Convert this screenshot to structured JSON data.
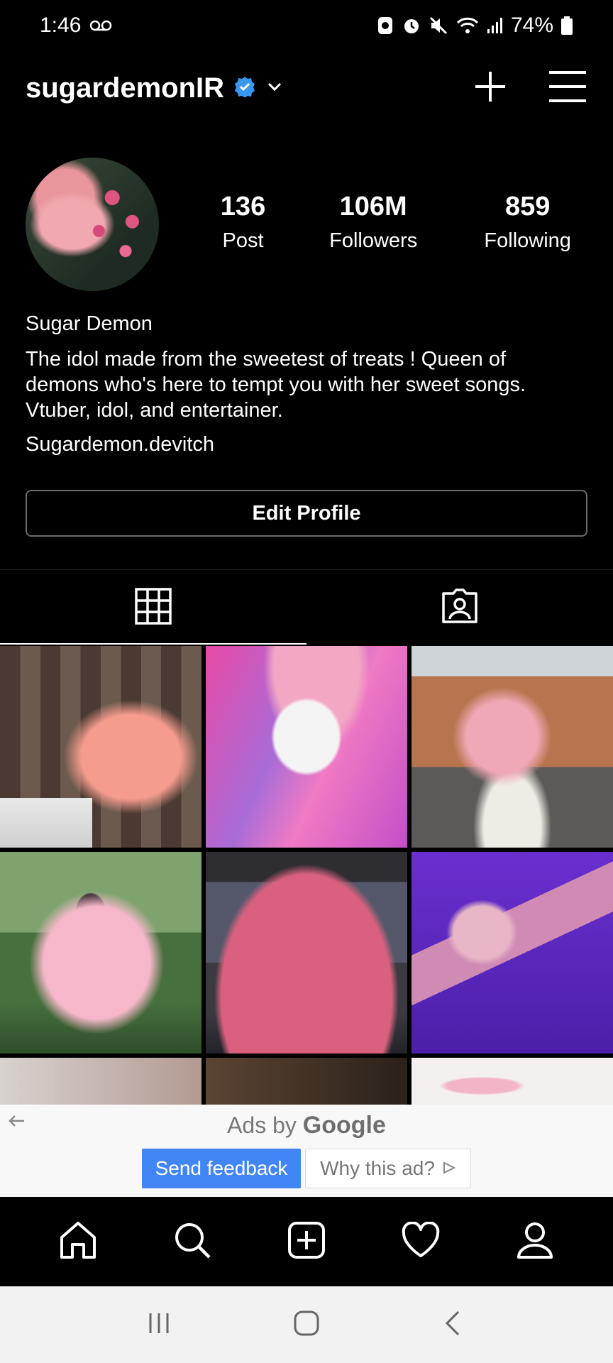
{
  "status_bar": {
    "time": "1:46",
    "battery": "74%",
    "icons": [
      "voicemail-icon",
      "data-saver-icon",
      "alarm-icon",
      "mute-icon",
      "wifi-icon",
      "signal-icon",
      "battery-icon"
    ]
  },
  "header": {
    "username": "sugardemonIR",
    "verified_color": "#3897f0",
    "icons": [
      "verified-badge-icon",
      "chevron-down-icon",
      "plus-icon",
      "menu-icon"
    ]
  },
  "profile": {
    "stats": [
      {
        "value": "136",
        "label": "Post"
      },
      {
        "value": "106M",
        "label": "Followers"
      },
      {
        "value": "859",
        "label": "Following"
      }
    ],
    "name": "Sugar Demon",
    "bio_lines": [
      "The idol made from the sweetest of treats ! Queen of",
      "demons who's here to tempt you with her sweet songs.",
      "Vtuber, idol, and entertainer."
    ],
    "link": "Sugardemon.devitch",
    "edit_button": "Edit Profile"
  },
  "tabs": [
    {
      "icon": "grid-icon",
      "selected": true
    },
    {
      "icon": "tagged-icon",
      "selected": false
    }
  ],
  "ad": {
    "title_prefix": "Ads by",
    "title_brand": "Google",
    "send_feedback": "Send feedback",
    "why_this_ad": "Why this ad?",
    "accent": "#4285f4"
  },
  "bottom_nav": [
    "home-icon",
    "search-icon",
    "new-post-icon",
    "heart-icon",
    "profile-icon"
  ],
  "system_nav": [
    "recents-icon",
    "home-button-icon",
    "back-icon"
  ]
}
